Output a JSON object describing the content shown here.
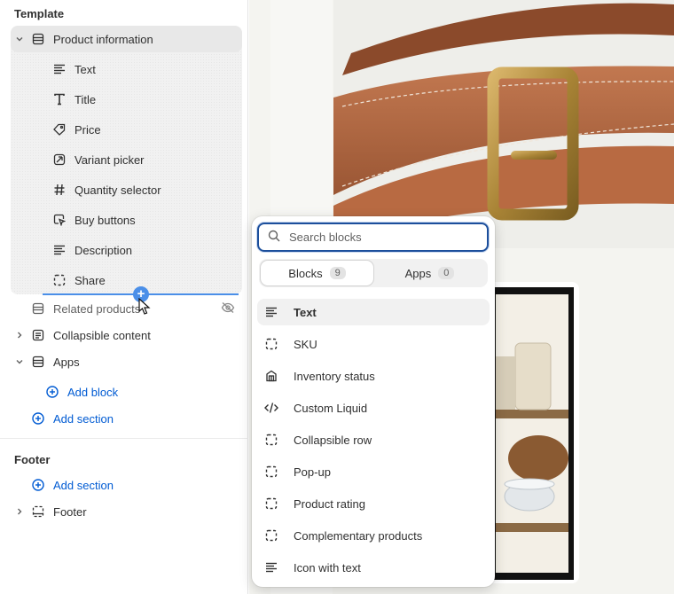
{
  "sidebar": {
    "template_heading": "Template",
    "product_information": "Product information",
    "children": [
      {
        "label": "Text",
        "icon": "text-lines-icon"
      },
      {
        "label": "Title",
        "icon": "title-t-icon"
      },
      {
        "label": "Price",
        "icon": "price-tag-icon"
      },
      {
        "label": "Variant picker",
        "icon": "variant-picker-icon"
      },
      {
        "label": "Quantity selector",
        "icon": "hashtag-icon"
      },
      {
        "label": "Buy buttons",
        "icon": "cursor-button-icon"
      },
      {
        "label": "Description",
        "icon": "text-lines-icon"
      },
      {
        "label": "Share",
        "icon": "dashed-square-icon"
      }
    ],
    "related_products": "Related products",
    "collapsible_content": "Collapsible content",
    "apps": "Apps",
    "add_block": "Add block",
    "add_section": "Add section",
    "footer_heading": "Footer",
    "footer_add_section": "Add section",
    "footer": "Footer"
  },
  "popover": {
    "search_placeholder": "Search blocks",
    "tabs": [
      {
        "label": "Blocks",
        "count": "9"
      },
      {
        "label": "Apps",
        "count": "0"
      }
    ],
    "blocks": [
      {
        "label": "Text",
        "icon": "text-lines-icon"
      },
      {
        "label": "SKU",
        "icon": "dashed-square-icon"
      },
      {
        "label": "Inventory status",
        "icon": "store-icon"
      },
      {
        "label": "Custom Liquid",
        "icon": "code-icon"
      },
      {
        "label": "Collapsible row",
        "icon": "dashed-square-icon"
      },
      {
        "label": "Pop-up",
        "icon": "dashed-square-icon"
      },
      {
        "label": "Product rating",
        "icon": "dashed-square-icon"
      },
      {
        "label": "Complementary products",
        "icon": "dashed-square-icon"
      },
      {
        "label": "Icon with text",
        "icon": "text-lines-icon"
      }
    ]
  },
  "colors": {
    "accent_link": "#005bd3",
    "focus_border": "#1c4f9c",
    "drop_indicator": "#4b8fe8"
  }
}
